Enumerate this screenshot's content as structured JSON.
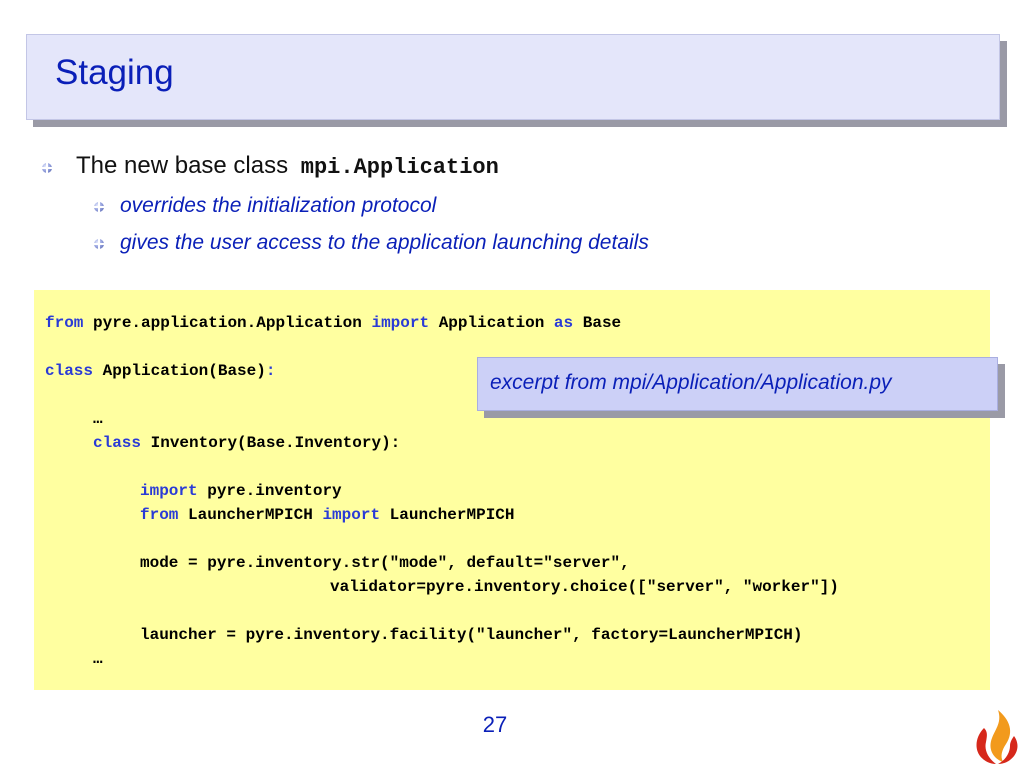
{
  "slide": {
    "title": "Staging",
    "page_number": "27"
  },
  "bullets": {
    "main": {
      "text": "The new base class",
      "code": "mpi.Application"
    },
    "sub": [
      "overrides the initialization protocol",
      "gives the user access to the application launching details"
    ]
  },
  "code_block": {
    "line1": [
      "from",
      "pyre.application.Application",
      "import",
      "Application",
      "as",
      "Base"
    ],
    "line2": [
      "class",
      "Application(Base)",
      ":"
    ],
    "line3": "…",
    "line4": [
      "class",
      "Inventory(Base.Inventory):"
    ],
    "line5": [
      "import",
      "pyre.inventory"
    ],
    "line6": [
      "from",
      "LauncherMPICH",
      "import",
      "LauncherMPICH"
    ],
    "line7": "mode = pyre.inventory.str(\"mode\", default=\"server\",",
    "line8": "validator=pyre.inventory.choice([\"server\", \"worker\"])",
    "line9": "launcher = pyre.inventory.facility(\"launcher\", factory=LauncherMPICH)",
    "line10": "…"
  },
  "callout": {
    "text": "excerpt from mpi/Application/Application.py"
  },
  "colors": {
    "title_blue": "#0a1fb8",
    "keyword_blue": "#2a3bd6",
    "code_background": "#ffffa0"
  },
  "icons": {
    "bullet": "globe-bullet-icon",
    "logo": "flame-logo-icon"
  }
}
